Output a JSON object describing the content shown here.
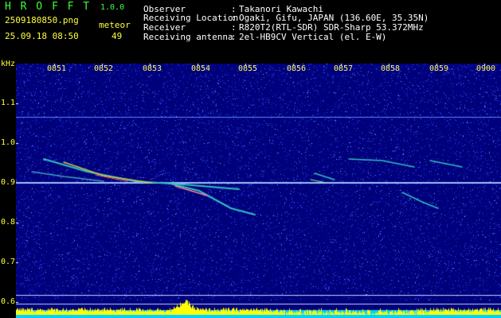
{
  "header": {
    "app_title": "H R O F F T",
    "app_version": "1.0.0",
    "file_name": "2509180850.png",
    "timestamp": "25.09.18 08:50",
    "meteor_label": "meteor",
    "meteor_count": "49"
  },
  "info": [
    {
      "label": "Observer",
      "value": "Takanori Kawachi"
    },
    {
      "label": "Receiving Location",
      "value": "Ogaki, Gifu, JAPAN (136.60E, 35.35N)"
    },
    {
      "label": "Receiver",
      "value": "R820T2(RTL-SDR) SDR-Sharp 53.372MHz"
    },
    {
      "label": "Receiving antenna",
      "value": "2el-HB9CV Vertical (el. E-W)"
    }
  ],
  "separator": ":",
  "y_axis": {
    "unit": "kHz",
    "labels": [
      "1.1",
      "1.0",
      "0.9",
      "0.8",
      "0.7",
      "0.6"
    ]
  },
  "x_axis": {
    "labels": [
      "0851",
      "0852",
      "0853",
      "0854",
      "0855",
      "0856",
      "0857",
      "0858",
      "0859",
      "0900"
    ]
  },
  "colors": {
    "background": "#000000",
    "spectrogram_base": "#00007a",
    "label_yellow": "#ffff3c",
    "header_green": "#3cff3c",
    "carrier_line": "#a0c0ff",
    "activity_bar": "#ffff00"
  }
}
